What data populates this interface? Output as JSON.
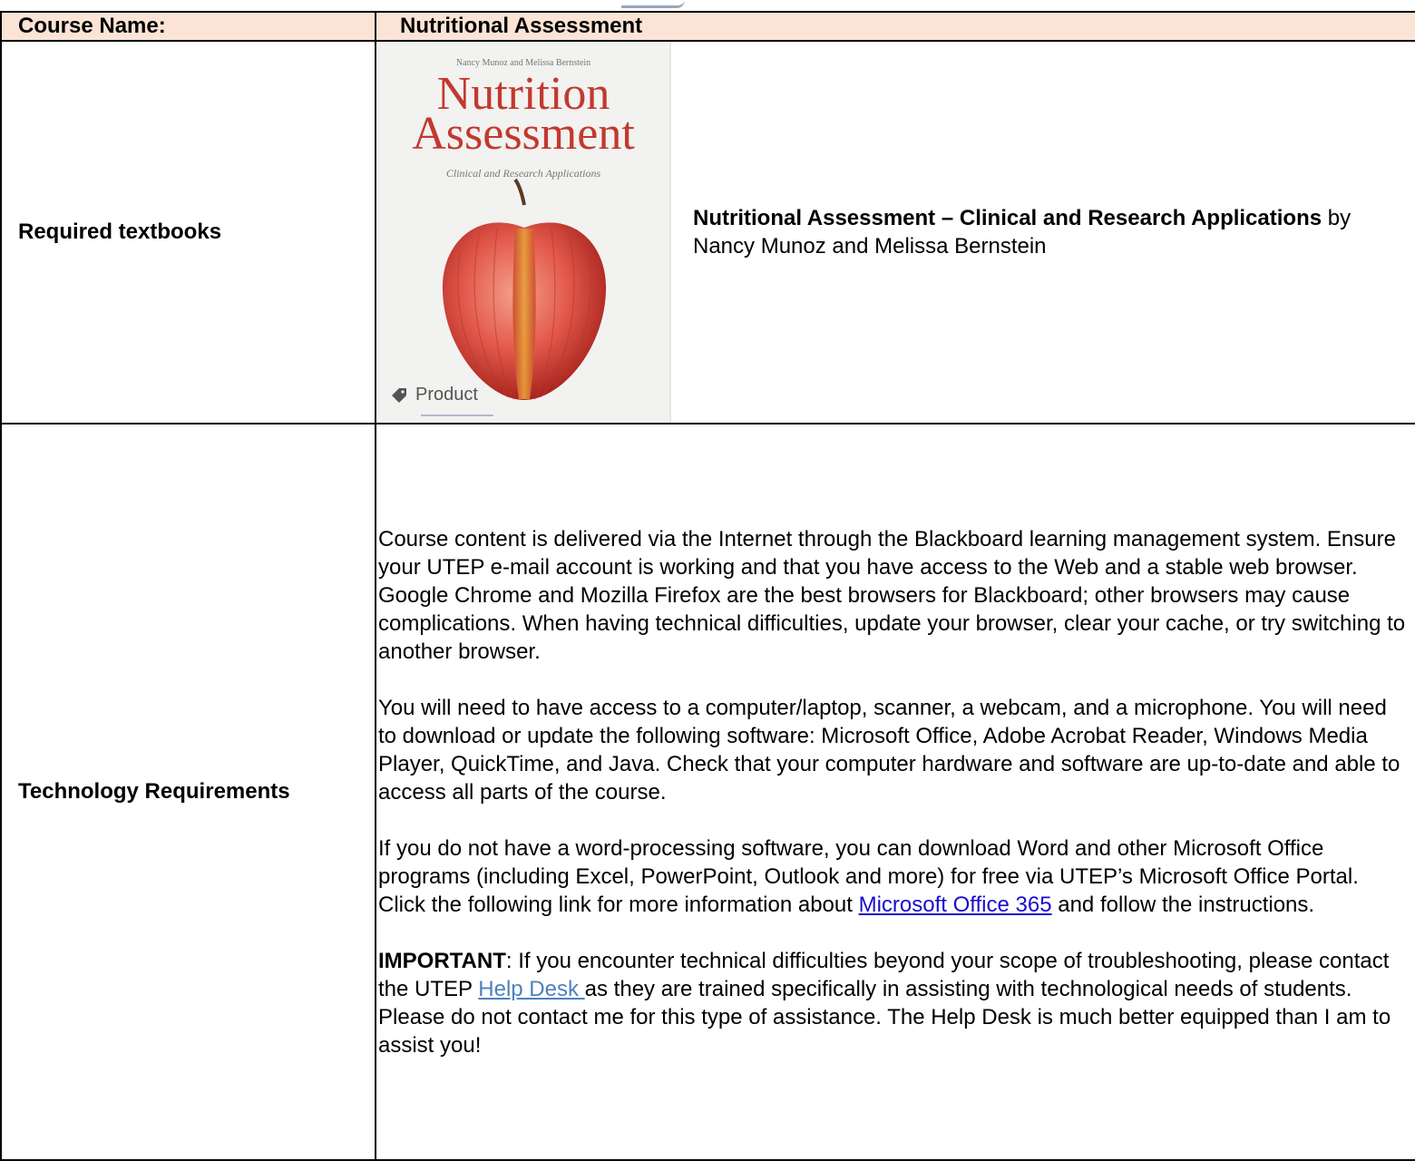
{
  "header": {
    "course_name_label": "Course Name:",
    "course_name_value": "Nutritional Assessment"
  },
  "textbooks": {
    "label": "Required textbooks",
    "cover": {
      "authors": "Nancy Munoz and Melissa Bernstein",
      "title_line1": "Nutrition",
      "title_line2": "Assessment",
      "subtitle": "Clinical and Research Applications",
      "tag_label": "Product",
      "tag_icon": "tag-icon"
    },
    "book_title": "Nutritional Assessment – Clinical and Research Applications",
    "book_byline": " by Nancy Munoz and Melissa Bernstein"
  },
  "technology": {
    "label": "Technology Requirements",
    "para1": "Course content is delivered via the Internet through the Blackboard learning management system. Ensure your UTEP e-mail account is working and that you have access to the Web and a stable web browser. Google Chrome and Mozilla Firefox are the best browsers for Blackboard; other browsers may cause complications. When having technical difficulties, update your browser, clear your cache, or try switching to another browser.",
    "para2": "You will need to have access to a computer/laptop, scanner, a webcam, and a microphone. You will need to download or update the following software: Microsoft Office, Adobe Acrobat Reader, Windows Media Player, QuickTime, and Java. Check that your computer hardware and software are up-to-date and able to access all parts of the course.",
    "para3_before": "If you do not have a word-processing software, you can download Word and other Microsoft Office programs (including Excel, PowerPoint, Outlook and more) for free via UTEP’s Microsoft Office Portal. Click the following link for more information about ",
    "para3_link": "Microsoft Office 365",
    "para3_after": " and follow the instructions.",
    "para4_bold": "IMPORTANT",
    "para4_before": ": If you encounter technical difficulties beyond your scope of troubleshooting, please contact the UTEP ",
    "para4_link": "Help Desk ",
    "para4_after": "as they are trained specifically in assisting with technological needs of students. Please do not contact me for this type of assistance. The Help Desk is much better equipped than I am to assist you!"
  },
  "colors": {
    "header_bg": "#fbe4d5",
    "link": "#1a0dcc",
    "help_link": "#4f81bd",
    "cover_title": "#c2392f"
  }
}
